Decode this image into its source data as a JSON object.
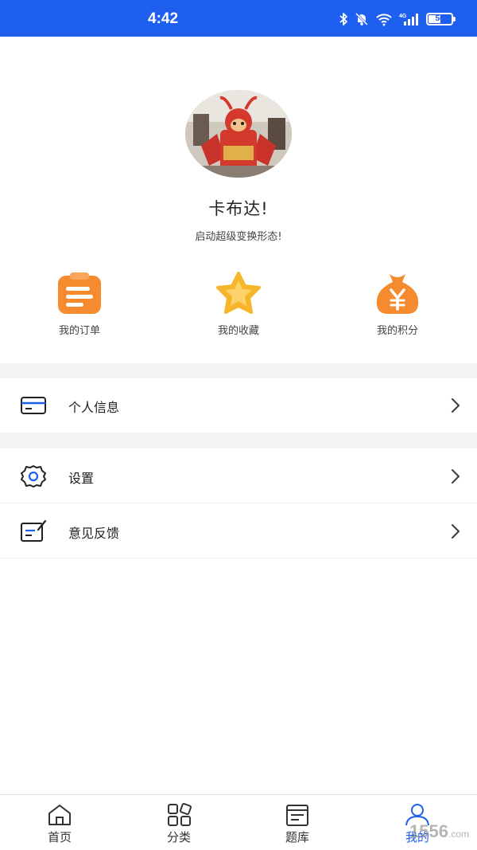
{
  "status_bar": {
    "time": "4:42",
    "battery": "50"
  },
  "profile": {
    "username": "卡布达!",
    "signature": "启动超级变换形态!"
  },
  "shortcuts": [
    {
      "label": "我的订单",
      "icon": "clipboard-icon"
    },
    {
      "label": "我的收藏",
      "icon": "star-icon"
    },
    {
      "label": "我的积分",
      "icon": "money-bag-icon"
    }
  ],
  "menu": {
    "personal_info": "个人信息",
    "settings": "设置",
    "feedback": "意见反馈"
  },
  "tabbar": [
    {
      "label": "首页",
      "icon": "home-icon"
    },
    {
      "label": "分类",
      "icon": "category-grid-icon"
    },
    {
      "label": "题库",
      "icon": "question-bank-icon"
    },
    {
      "label": "我的",
      "icon": "user-icon",
      "active": true
    }
  ],
  "watermark": {
    "main": "1556",
    "suffix": ".com"
  },
  "colors": {
    "primary": "#1f5ff0",
    "orange": "#f58a2e",
    "star": "#f7b52c",
    "divider": "#f2f3f5"
  }
}
